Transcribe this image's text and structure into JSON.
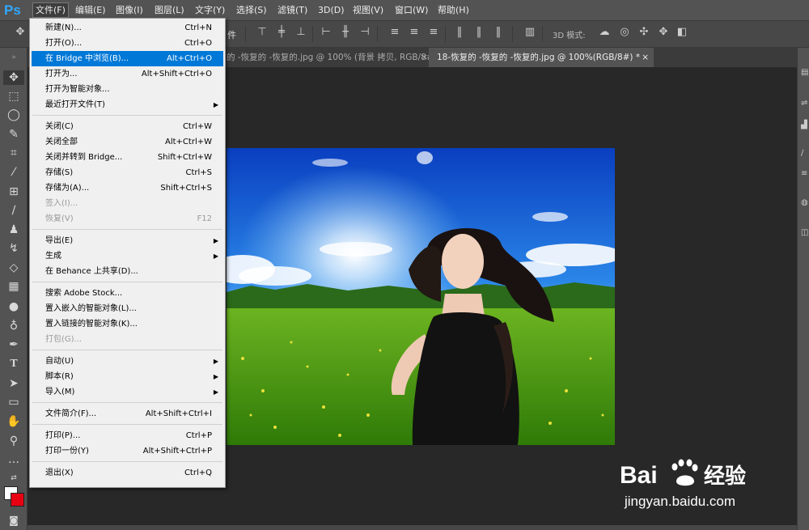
{
  "app": {
    "logo": "Ps"
  },
  "menubar": {
    "items": [
      "文件(F)",
      "编辑(E)",
      "图像(I)",
      "图层(L)",
      "文字(Y)",
      "选择(S)",
      "滤镜(T)",
      "3D(D)",
      "视图(V)",
      "窗口(W)",
      "帮助(H)"
    ]
  },
  "options": {
    "partial_label": "件",
    "mode_3d": "3D 模式:"
  },
  "tabs": [
    {
      "label": "的 -恢复的 -恢复的.jpg @ 100% (背景 拷贝, RGB/8#) *",
      "close": "×"
    },
    {
      "label": "18-恢复的 -恢复的 -恢复的.jpg @ 100%(RGB/8#) *",
      "close": "×"
    }
  ],
  "file_menu": {
    "items": [
      {
        "label": "新建(N)...",
        "shortcut": "Ctrl+N"
      },
      {
        "label": "打开(O)...",
        "shortcut": "Ctrl+O"
      },
      {
        "label": "在 Bridge 中浏览(B)...",
        "shortcut": "Alt+Ctrl+O",
        "highlighted": true
      },
      {
        "label": "打开为...",
        "shortcut": "Alt+Shift+Ctrl+O"
      },
      {
        "label": "打开为智能对象...",
        "shortcut": ""
      },
      {
        "label": "最近打开文件(T)",
        "shortcut": "",
        "submenu": true
      },
      {
        "separator": true
      },
      {
        "label": "关闭(C)",
        "shortcut": "Ctrl+W"
      },
      {
        "label": "关闭全部",
        "shortcut": "Alt+Ctrl+W"
      },
      {
        "label": "关闭并转到 Bridge...",
        "shortcut": "Shift+Ctrl+W"
      },
      {
        "label": "存储(S)",
        "shortcut": "Ctrl+S"
      },
      {
        "label": "存储为(A)...",
        "shortcut": "Shift+Ctrl+S"
      },
      {
        "label": "签入(I)...",
        "shortcut": "",
        "disabled": true
      },
      {
        "label": "恢复(V)",
        "shortcut": "F12",
        "disabled": true
      },
      {
        "separator": true
      },
      {
        "label": "导出(E)",
        "shortcut": "",
        "submenu": true
      },
      {
        "label": "生成",
        "shortcut": "",
        "submenu": true
      },
      {
        "label": "在 Behance 上共享(D)...",
        "shortcut": ""
      },
      {
        "separator": true
      },
      {
        "label": "搜索 Adobe Stock...",
        "shortcut": ""
      },
      {
        "label": "置入嵌入的智能对象(L)...",
        "shortcut": ""
      },
      {
        "label": "置入链接的智能对象(K)...",
        "shortcut": ""
      },
      {
        "label": "打包(G)...",
        "shortcut": "",
        "disabled": true
      },
      {
        "separator": true
      },
      {
        "label": "自动(U)",
        "shortcut": "",
        "submenu": true
      },
      {
        "label": "脚本(R)",
        "shortcut": "",
        "submenu": true
      },
      {
        "label": "导入(M)",
        "shortcut": "",
        "submenu": true
      },
      {
        "separator": true
      },
      {
        "label": "文件简介(F)...",
        "shortcut": "Alt+Shift+Ctrl+I"
      },
      {
        "separator": true
      },
      {
        "label": "打印(P)...",
        "shortcut": "Ctrl+P"
      },
      {
        "label": "打印一份(Y)",
        "shortcut": "Alt+Shift+Ctrl+P"
      },
      {
        "separator": true
      },
      {
        "label": "退出(X)",
        "shortcut": "Ctrl+Q"
      }
    ]
  },
  "colors": {
    "foreground": "#ffffff",
    "background": "#e60012",
    "highlight": "#0078d7"
  },
  "watermark": {
    "brand_prefix": "Bai",
    "brand_suffix": "经验",
    "url": "jingyan.baidu.com"
  }
}
